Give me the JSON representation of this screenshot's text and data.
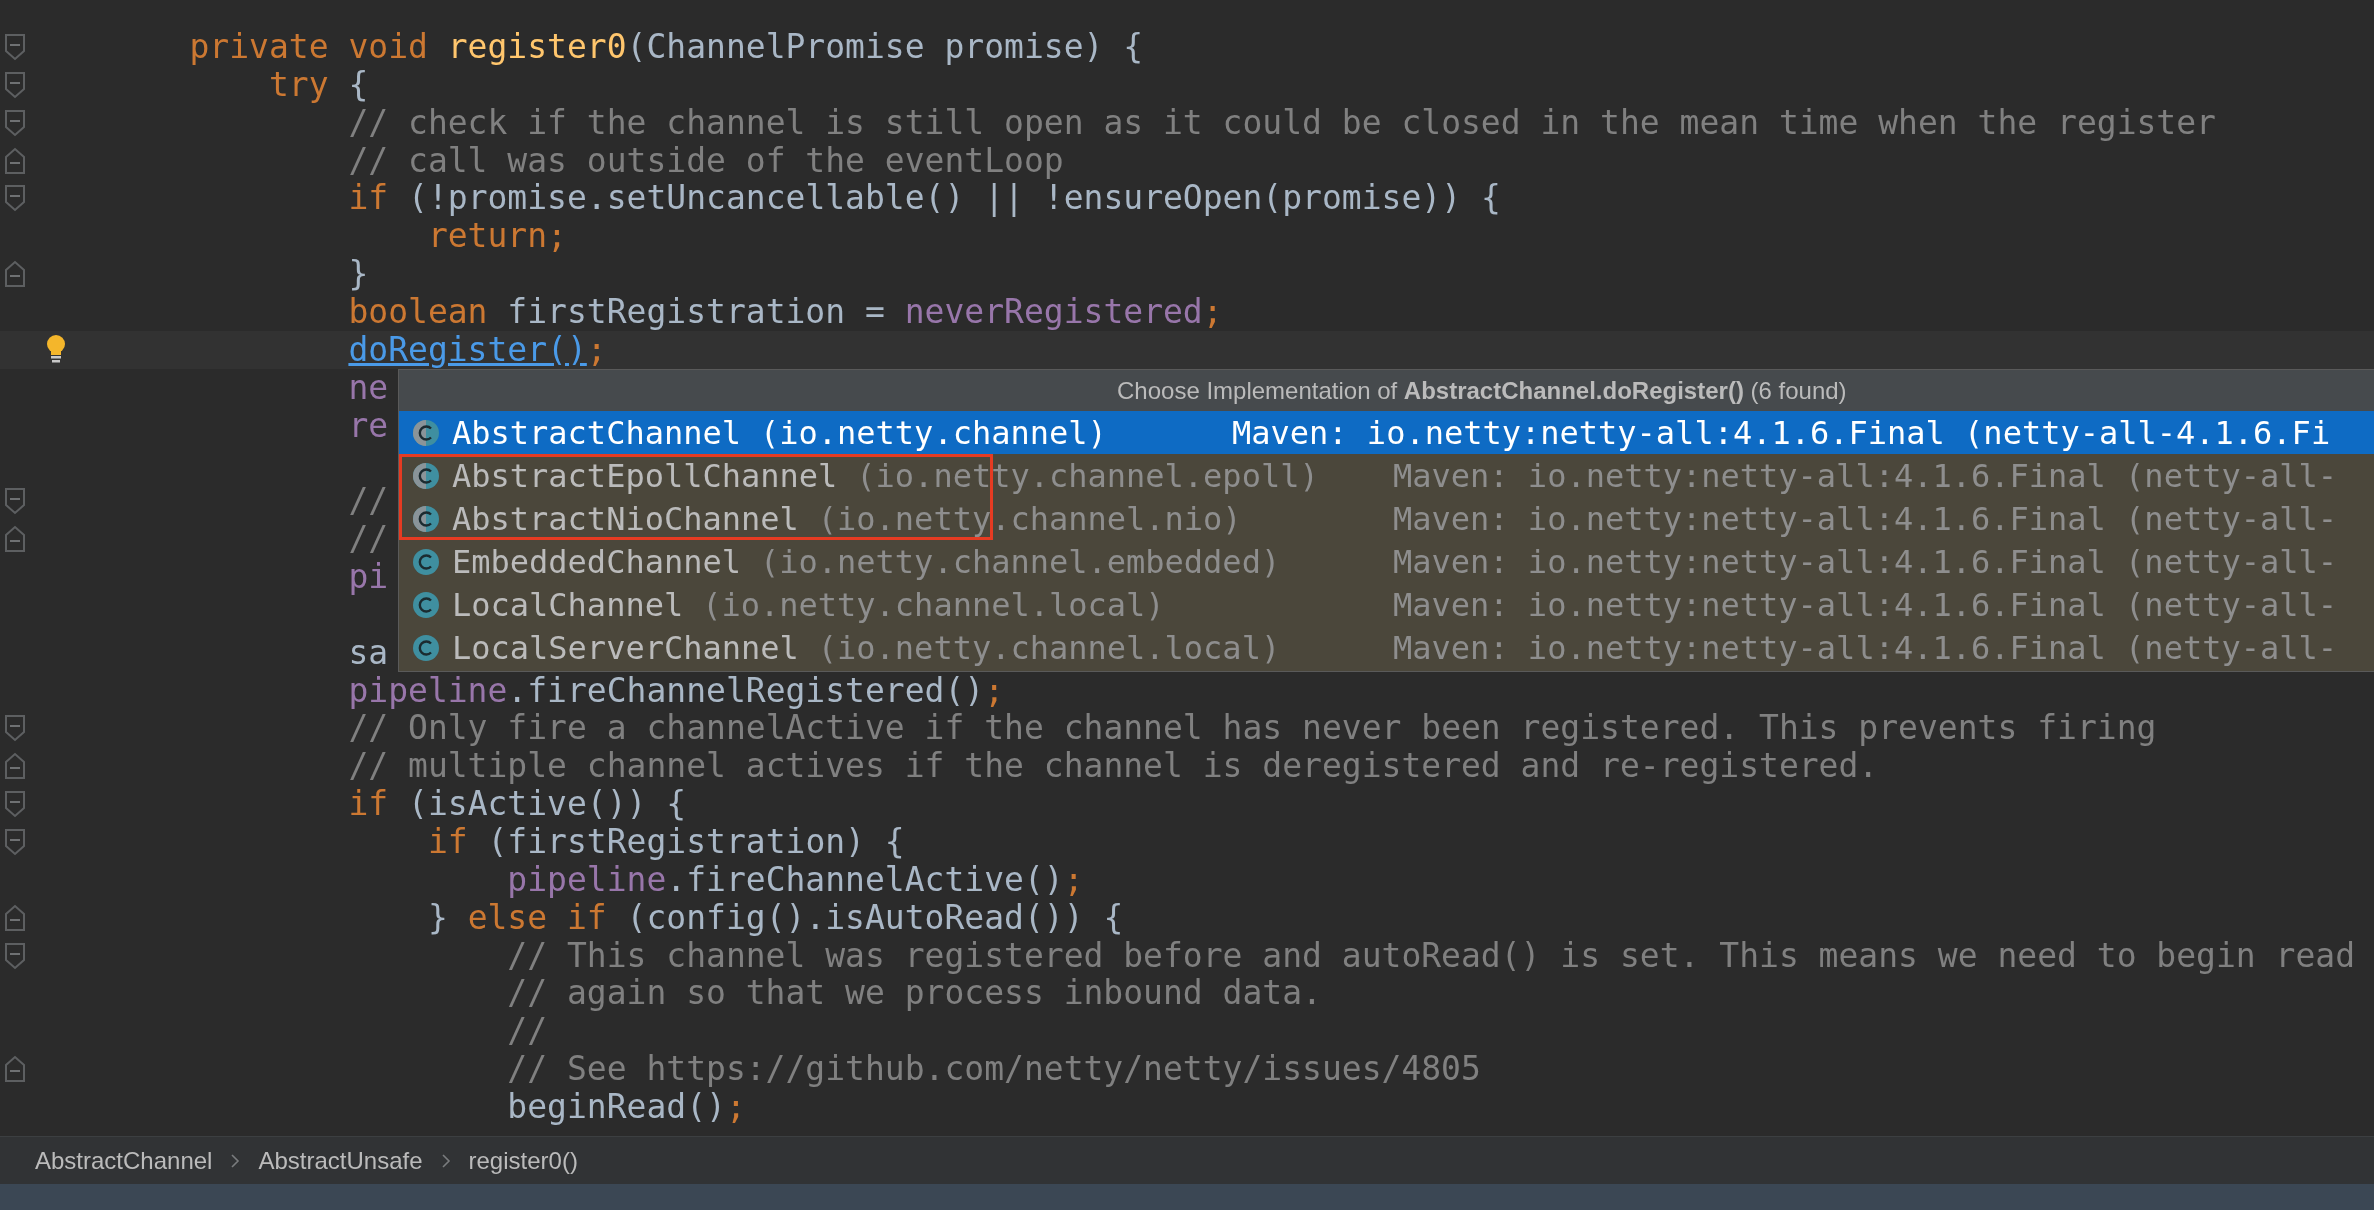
{
  "editor": {
    "lines": [
      {
        "kind": "code",
        "fold": {
          "kind": "start"
        },
        "tokens": [
          {
            "kind": "keyword",
            "text": "    private void "
          },
          {
            "kind": "declaration",
            "text": "register0"
          },
          {
            "kind": "plain",
            "text": "(ChannelPromise promise) {"
          }
        ]
      },
      {
        "kind": "code",
        "fold": {
          "kind": "start"
        },
        "tokens": [
          {
            "kind": "keyword",
            "text": "        try"
          },
          {
            "kind": "plain",
            "text": " {"
          }
        ]
      },
      {
        "kind": "code",
        "fold": {
          "kind": "start"
        },
        "tokens": [
          {
            "kind": "comment",
            "text": "            // check if the channel is still open as it could be closed in the mean time when the register"
          }
        ]
      },
      {
        "kind": "code",
        "fold": {
          "kind": "end"
        },
        "tokens": [
          {
            "kind": "comment",
            "text": "            // call was outside of the eventLoop"
          }
        ]
      },
      {
        "kind": "code",
        "fold": {
          "kind": "start"
        },
        "tokens": [
          {
            "kind": "keyword",
            "text": "            if"
          },
          {
            "kind": "plain",
            "text": " (!promise.setUncancellable() || !ensureOpen(promise)) {"
          }
        ]
      },
      {
        "kind": "code",
        "tokens": [
          {
            "kind": "keyword",
            "text": "                return;"
          }
        ]
      },
      {
        "kind": "code",
        "fold": {
          "kind": "end"
        },
        "tokens": [
          {
            "kind": "plain",
            "text": "            }"
          }
        ]
      },
      {
        "kind": "code",
        "tokens": [
          {
            "kind": "keyword",
            "text": "            boolean"
          },
          {
            "kind": "plain",
            "text": " firstRegistration = "
          },
          {
            "kind": "field",
            "text": "neverRegistered"
          },
          {
            "kind": "keyword",
            "text": ";"
          }
        ]
      },
      {
        "kind": "code",
        "current": true,
        "gutter_icon": {
          "kind": "bulb"
        },
        "tokens": [
          {
            "kind": "link",
            "text": "            doRegister()"
          },
          {
            "kind": "keyword",
            "text": ";"
          }
        ]
      },
      {
        "kind": "code",
        "tokens": [
          {
            "kind": "field",
            "text": "            ne"
          }
        ]
      },
      {
        "kind": "code",
        "tokens": [
          {
            "kind": "field",
            "text": "            re"
          }
        ]
      },
      {
        "kind": "blank"
      },
      {
        "kind": "code",
        "fold": {
          "kind": "start"
        },
        "tokens": [
          {
            "kind": "comment",
            "text": "            //"
          }
        ]
      },
      {
        "kind": "code",
        "fold": {
          "kind": "end"
        },
        "tokens": [
          {
            "kind": "comment",
            "text": "            //"
          }
        ]
      },
      {
        "kind": "code",
        "tokens": [
          {
            "kind": "field",
            "text": "            pi"
          }
        ]
      },
      {
        "kind": "blank"
      },
      {
        "kind": "code",
        "tokens": [
          {
            "kind": "plain",
            "text": "            sa"
          }
        ]
      },
      {
        "kind": "code",
        "tokens": [
          {
            "kind": "field",
            "text": "            pipeline"
          },
          {
            "kind": "plain",
            "text": ".fireChannelRegistered()"
          },
          {
            "kind": "keyword",
            "text": ";"
          }
        ]
      },
      {
        "kind": "code",
        "fold": {
          "kind": "start"
        },
        "tokens": [
          {
            "kind": "comment",
            "text": "            // Only fire a channelActive if the channel has never been registered. This prevents firing"
          }
        ]
      },
      {
        "kind": "code",
        "fold": {
          "kind": "end"
        },
        "tokens": [
          {
            "kind": "comment",
            "text": "            // multiple channel actives if the channel is deregistered and re-registered."
          }
        ]
      },
      {
        "kind": "code",
        "fold": {
          "kind": "start"
        },
        "tokens": [
          {
            "kind": "keyword",
            "text": "            if"
          },
          {
            "kind": "plain",
            "text": " (isActive()) {"
          }
        ]
      },
      {
        "kind": "code",
        "fold": {
          "kind": "start"
        },
        "tokens": [
          {
            "kind": "keyword",
            "text": "                if"
          },
          {
            "kind": "plain",
            "text": " (firstRegistration) {"
          }
        ]
      },
      {
        "kind": "code",
        "tokens": [
          {
            "kind": "field",
            "text": "                    pipeline"
          },
          {
            "kind": "plain",
            "text": ".fireChannelActive()"
          },
          {
            "kind": "keyword",
            "text": ";"
          }
        ]
      },
      {
        "kind": "code",
        "fold": {
          "kind": "end"
        },
        "tokens": [
          {
            "kind": "plain",
            "text": "                } "
          },
          {
            "kind": "keyword",
            "text": "else if"
          },
          {
            "kind": "plain",
            "text": " (config().isAutoRead()) {"
          }
        ]
      },
      {
        "kind": "code",
        "fold": {
          "kind": "start"
        },
        "tokens": [
          {
            "kind": "comment",
            "text": "                    // This channel was registered before and autoRead() is set. This means we need to begin read"
          }
        ]
      },
      {
        "kind": "code",
        "tokens": [
          {
            "kind": "comment",
            "text": "                    // again so that we process inbound data."
          }
        ]
      },
      {
        "kind": "code",
        "tokens": [
          {
            "kind": "comment",
            "text": "                    //"
          }
        ]
      },
      {
        "kind": "code",
        "fold": {
          "kind": "end"
        },
        "tokens": [
          {
            "kind": "comment",
            "text": "                    // See https://github.com/netty/netty/issues/4805"
          }
        ]
      },
      {
        "kind": "code",
        "tokens": [
          {
            "kind": "plain",
            "text": "                    beginRead()"
          },
          {
            "kind": "keyword",
            "text": ";"
          }
        ]
      }
    ]
  },
  "popup": {
    "title": "Choose Implementation of **AbstractChannel.doRegister()** (6 found)",
    "items": [
      {
        "name": "AbstractChannel",
        "package": "(io.netty.channel)",
        "source": "Maven: io.netty:netty-all:4.1.6.Final (netty-all-4.1.6.Fi",
        "selected": true,
        "framed": false,
        "abstract": true
      },
      {
        "name": "AbstractEpollChannel",
        "package": "(io.netty.channel.epoll)",
        "source": "Maven: io.netty:netty-all:4.1.6.Final (netty-all-",
        "selected": false,
        "framed": true,
        "abstract": true
      },
      {
        "name": "AbstractNioChannel",
        "package": "(io.netty.channel.nio)",
        "source": "Maven: io.netty:netty-all:4.1.6.Final (netty-all-",
        "selected": false,
        "framed": true,
        "abstract": true
      },
      {
        "name": "EmbeddedChannel",
        "package": "(io.netty.channel.embedded)",
        "source": "Maven: io.netty:netty-all:4.1.6.Final (netty-all-",
        "selected": false,
        "framed": false,
        "abstract": false
      },
      {
        "name": "LocalChannel",
        "package": "(io.netty.channel.local)",
        "source": "Maven: io.netty:netty-all:4.1.6.Final (netty-all-",
        "selected": false,
        "framed": false,
        "abstract": false
      },
      {
        "name": "LocalServerChannel",
        "package": "(io.netty.channel.local)",
        "source": "Maven: io.netty:netty-all:4.1.6.Final (netty-all-",
        "selected": false,
        "framed": false,
        "abstract": false
      }
    ]
  },
  "breadcrumbs": [
    "AbstractChannel",
    "AbstractUnsafe",
    "register0()"
  ]
}
